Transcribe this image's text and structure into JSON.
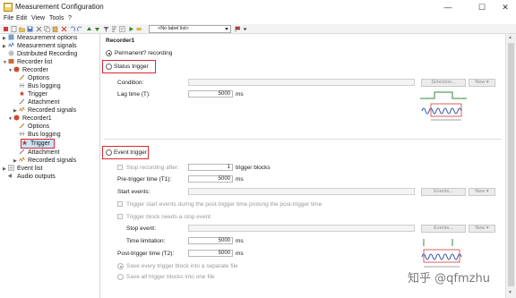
{
  "window": {
    "title": "Measurement Configuration",
    "minimize": "—",
    "maximize": "☐",
    "close": "✕"
  },
  "menu": [
    "File",
    "Edit",
    "View",
    "Tools",
    "?"
  ],
  "toolbar": {
    "label_select": "<No label list>"
  },
  "tree": [
    {
      "label": "Measurement options",
      "icon": "options-icon"
    },
    {
      "label": "Measurement signals",
      "icon": "signals-icon"
    },
    {
      "label": "Distributed Recording",
      "icon": "distributed-icon"
    },
    {
      "label": "Recorder list",
      "icon": "recorder-list-icon"
    },
    {
      "label": "Recorder",
      "icon": "recorder-icon"
    },
    {
      "label": "Options",
      "icon": "options-icon"
    },
    {
      "label": "Bus logging",
      "icon": "bus-icon"
    },
    {
      "label": "Trigger",
      "icon": "trigger-icon"
    },
    {
      "label": "Attachment",
      "icon": "attachment-icon"
    },
    {
      "label": "Recorded signals",
      "icon": "signals-icon"
    },
    {
      "label": "Recorder1",
      "icon": "recorder-icon"
    },
    {
      "label": "Options",
      "icon": "options-icon"
    },
    {
      "label": "Bus logging",
      "icon": "bus-icon"
    },
    {
      "label": "Trigger",
      "icon": "trigger-icon"
    },
    {
      "label": "Attachment",
      "icon": "attachment-icon"
    },
    {
      "label": "Recorded signals",
      "icon": "signals-icon"
    },
    {
      "label": "Event list",
      "icon": "event-list-icon"
    },
    {
      "label": "Audio outputs",
      "icon": "audio-icon"
    }
  ],
  "panel": {
    "heading": "Recorder1",
    "permanent_recording": "Permanent? recording",
    "status_trigger": {
      "label": "Status trigger",
      "condition_label": "Condition:",
      "selection_button": "Selection...",
      "new_button": "New",
      "lag_time_label": "Lag time (T):",
      "lag_time_value": "5000",
      "lag_time_unit": "ms"
    },
    "event_trigger": {
      "label": "Event trigger",
      "stop_after_label": "Stop recording after:",
      "stop_after_value": "1",
      "stop_after_unit": "trigger blocks",
      "pretrigger_label": "Pre-trigger time (T1):",
      "pretrigger_value": "5000",
      "pretrigger_unit": "ms",
      "start_events_label": "Start events:",
      "events_button": "Events...",
      "new_button": "New",
      "prolong_label": "Trigger start events during the post-trigger time prolong the post-trigger time",
      "needs_stop_label": "Trigger block needs a stop event",
      "stop_event_label": "Stop event:",
      "time_limit_label": "Time limitation:",
      "time_limit_value": "5000",
      "time_limit_unit": "ms",
      "posttrigger_label": "Post-trigger time (T2):",
      "posttrigger_value": "5000",
      "posttrigger_unit": "ms",
      "separate_file_label": "Save every trigger block into a separate file",
      "one_file_label": "Save all trigger blocks into one file"
    }
  },
  "watermark": "知乎 @qfmzhu"
}
